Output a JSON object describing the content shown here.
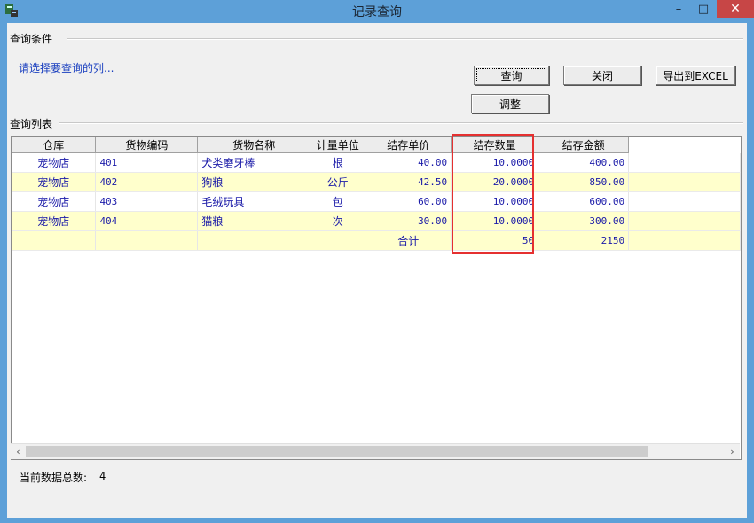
{
  "window": {
    "title": "记录查询",
    "minimize": "–",
    "maximize": "□",
    "close": "✕"
  },
  "conditions": {
    "section_label": "查询条件",
    "hint": "请选择要查询的列..."
  },
  "buttons": {
    "query": "查询",
    "close": "关闭",
    "export": "导出到EXCEL",
    "adjust": "调整"
  },
  "list": {
    "section_label": "查询列表",
    "columns": [
      "仓库",
      "货物编码",
      "货物名称",
      "计量单位",
      "结存单价",
      "结存数量",
      "结存金额"
    ],
    "rows": [
      {
        "warehouse": "宠物店",
        "code": "401",
        "name": "犬类磨牙棒",
        "unit": "根",
        "price": "40.00",
        "qty": "10.0000",
        "amount": "400.00"
      },
      {
        "warehouse": "宠物店",
        "code": "402",
        "name": "狗粮",
        "unit": "公斤",
        "price": "42.50",
        "qty": "20.0000",
        "amount": "850.00"
      },
      {
        "warehouse": "宠物店",
        "code": "403",
        "name": "毛绒玩具",
        "unit": "包",
        "price": "60.00",
        "qty": "10.0000",
        "amount": "600.00"
      },
      {
        "warehouse": "宠物店",
        "code": "404",
        "name": "猫粮",
        "unit": "次",
        "price": "30.00",
        "qty": "10.0000",
        "amount": "300.00"
      }
    ],
    "summary": {
      "label": "合计",
      "qty": "50",
      "amount": "2150"
    }
  },
  "footer": {
    "count_label": "当前数据总数:",
    "count_value": "4"
  },
  "scrollbar": {
    "left": "‹",
    "right": "›"
  }
}
